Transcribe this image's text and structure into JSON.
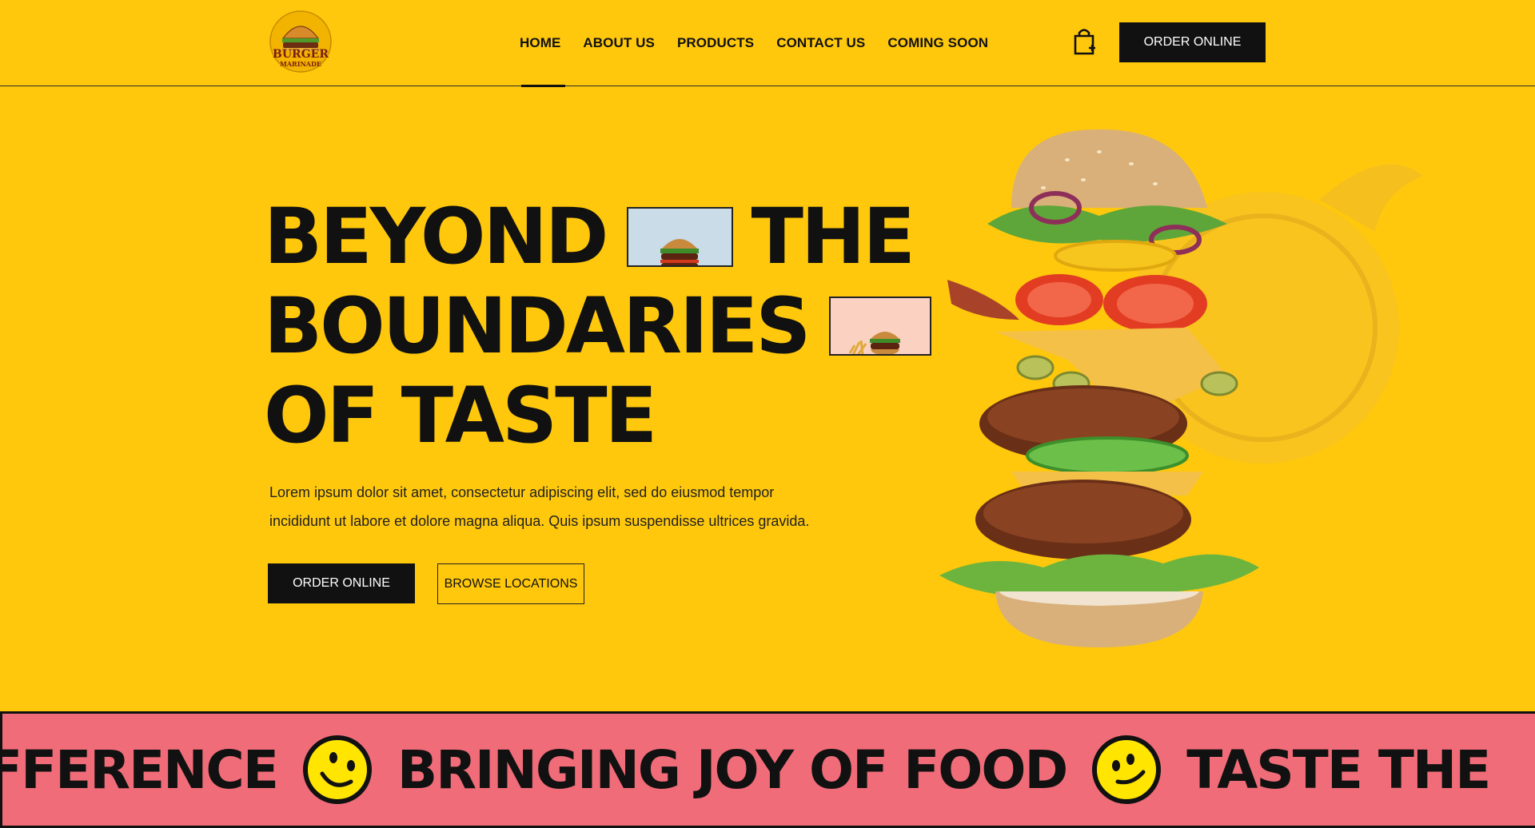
{
  "header": {
    "nav": [
      {
        "label": "HOME",
        "active": true
      },
      {
        "label": "ABOUT US",
        "active": false
      },
      {
        "label": "PRODUCTS",
        "active": false
      },
      {
        "label": "CONTACT US",
        "active": false
      },
      {
        "label": "COMING SOON",
        "active": false
      }
    ],
    "order_button": "ORDER ONLINE",
    "logo_text": "BURGER MARINADE"
  },
  "hero": {
    "headline": {
      "line1_a": "BEYOND",
      "line1_b": "THE",
      "line2": "BOUNDARIES",
      "line3": "OF TASTE"
    },
    "description_line1": "Lorem ipsum dolor sit amet, consectetur adipiscing elit, sed do eiusmod tempor",
    "description_line2": "incididunt ut labore et dolore magna aliqua. Quis ipsum suspendisse ultrices gravida.",
    "order_button": "ORDER ONLINE",
    "browse_button": "BROWSE LOCATIONS"
  },
  "marquee": {
    "items": [
      "FFERENCE",
      "BRINGING JOY OF FOOD",
      "TASTE THE"
    ]
  },
  "colors": {
    "background": "#FFC80C",
    "accent_dark": "#111111",
    "marquee_bg": "#F06C78",
    "smiley": "#FFE500"
  }
}
